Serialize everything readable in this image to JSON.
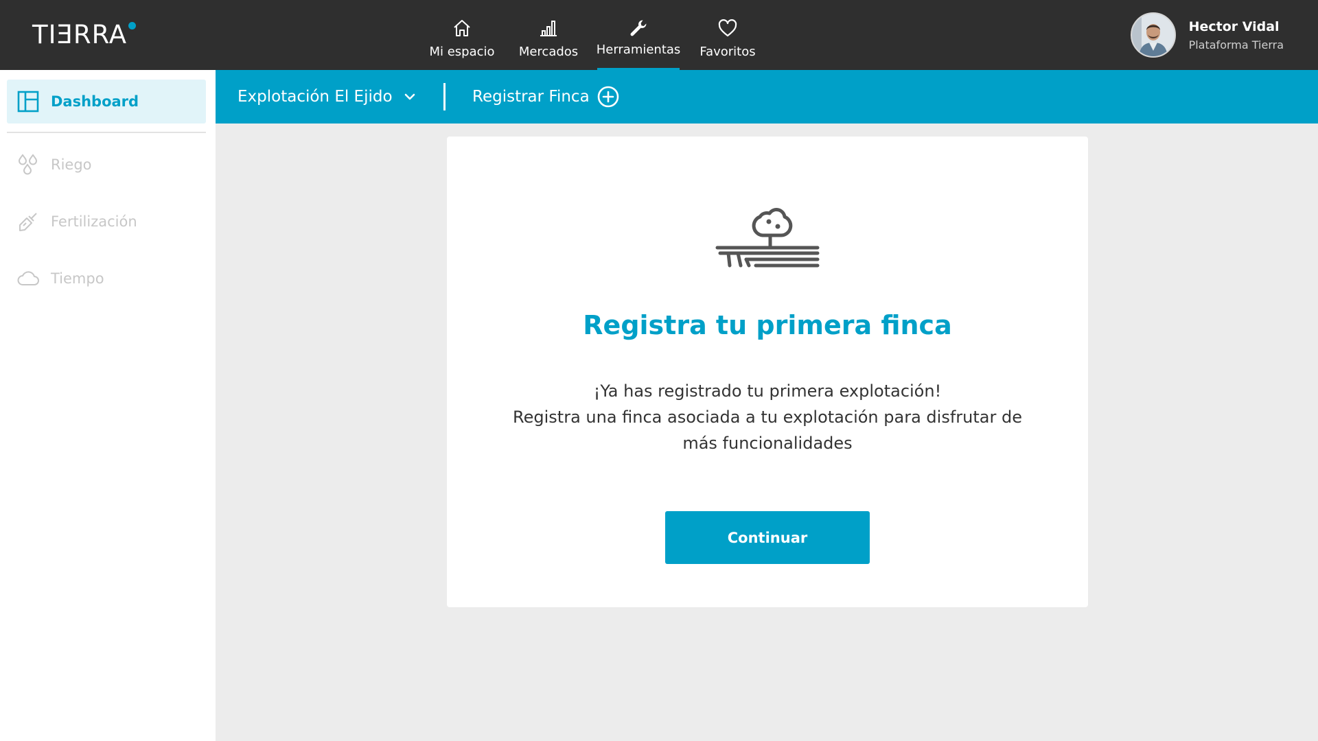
{
  "app": {
    "logo_text": "TIƎRRA",
    "accent_color": "#00a0c8"
  },
  "topnav": {
    "items": [
      {
        "label": "Mi espacio",
        "icon": "home-icon"
      },
      {
        "label": "Mercados",
        "icon": "bar-chart-icon"
      },
      {
        "label": "Herramientas",
        "icon": "wrench-icon",
        "active": true
      },
      {
        "label": "Favoritos",
        "icon": "heart-icon"
      }
    ]
  },
  "user": {
    "name": "Hector Vidal",
    "subtitle": "Plataforma Tierra"
  },
  "sidebar": {
    "items": [
      {
        "label": "Dashboard",
        "icon": "dashboard-icon",
        "active": true
      },
      {
        "label": "Riego",
        "icon": "water-drops-icon"
      },
      {
        "label": "Fertilización",
        "icon": "fertilizer-icon"
      },
      {
        "label": "Tiempo",
        "icon": "cloud-icon"
      }
    ]
  },
  "subbar": {
    "farm_select": "Explotación El Ejido",
    "register_label": "Registrar Finca"
  },
  "card": {
    "title": "Registra tu primera finca",
    "line1": "¡Ya has registrado tu primera explotación!",
    "line2": "Registra una finca asociada a tu explotación para disfrutar de",
    "line3": "más funcionalidades",
    "button": "Continuar"
  }
}
